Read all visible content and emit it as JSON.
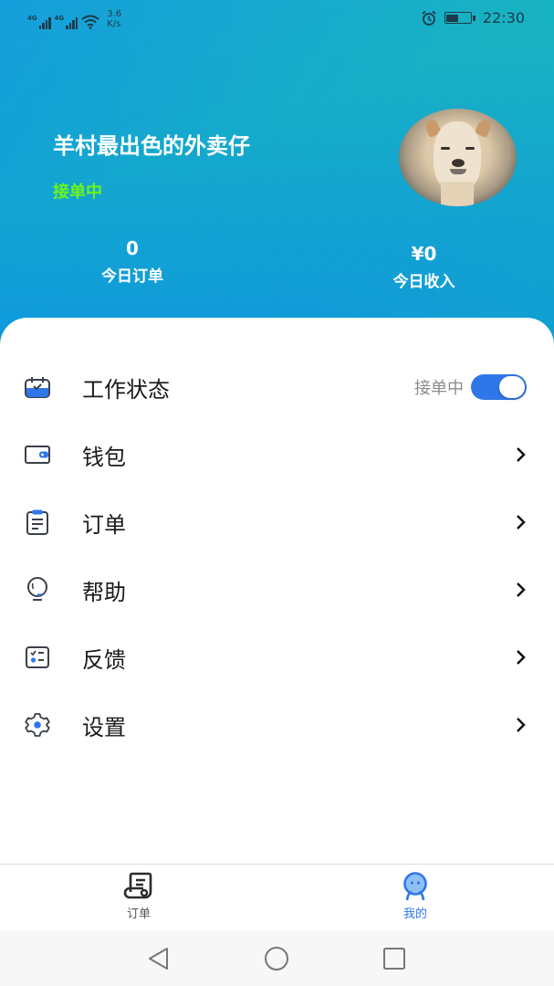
{
  "status_bar": {
    "network_1": "4G",
    "network_2": "4G",
    "speed_value": "3.6",
    "speed_unit": "K/s",
    "time": "22:30",
    "battery_level_percent": 50,
    "icons": [
      "signal-icon",
      "signal-icon",
      "wifi-icon",
      "alarm-icon",
      "battery-icon"
    ]
  },
  "profile": {
    "name": "羊村最出色的外卖仔",
    "status": "接单中",
    "avatar": "alpaca-avatar",
    "status_color": "#6cf51c"
  },
  "stats": {
    "orders": {
      "value": "0",
      "label": "今日订单"
    },
    "income": {
      "value": "¥0",
      "label": "今日收入"
    }
  },
  "menu": {
    "items": [
      {
        "label": "工作状态",
        "icon": "calendar-check-icon",
        "toggle_label": "接单中",
        "toggle_on": true
      },
      {
        "label": "钱包",
        "icon": "wallet-icon"
      },
      {
        "label": "订单",
        "icon": "clipboard-icon"
      },
      {
        "label": "帮助",
        "icon": "lightbulb-icon"
      },
      {
        "label": "反馈",
        "icon": "checklist-icon"
      },
      {
        "label": "设置",
        "icon": "gear-icon"
      }
    ]
  },
  "tabbar": {
    "tabs": [
      {
        "label": "订单",
        "icon": "scroll-icon",
        "active": false
      },
      {
        "label": "我的",
        "icon": "robot-face-icon",
        "active": true
      }
    ],
    "active_color": "#2f77e8"
  },
  "navbar": {
    "buttons": [
      "back-icon",
      "home-icon",
      "recents-icon"
    ]
  },
  "colors": {
    "accent": "#2f77e8",
    "header_gradient_start": "#0c8fe3",
    "header_gradient_end": "#1cbab4"
  }
}
